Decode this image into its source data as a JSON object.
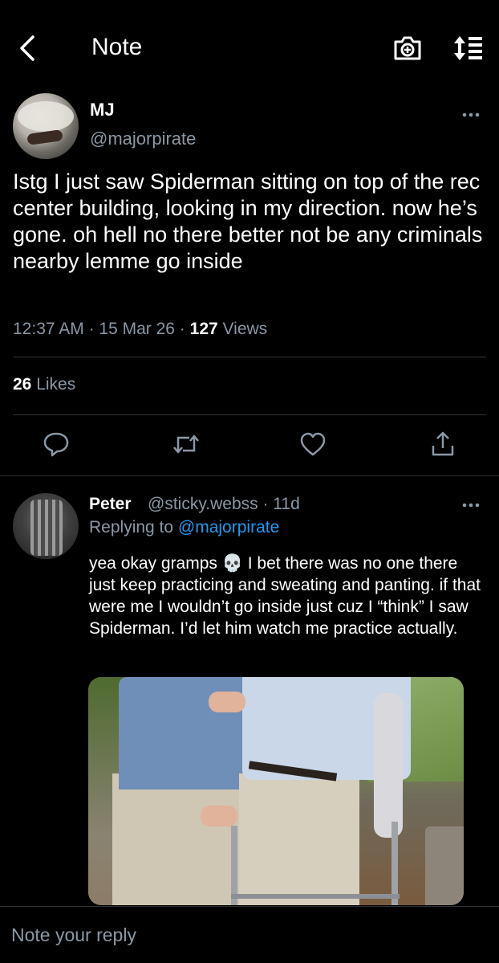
{
  "header": {
    "title": "Note",
    "icons": [
      "back-chevron-icon",
      "camera-icon",
      "sort-icon"
    ]
  },
  "tweet": {
    "author_name": "MJ",
    "author_handle": "@majorpirate",
    "text": "Istg I just saw Spiderman sitting on top of the rec center building, looking in my direction. now he’s gone. oh hell no there better not be any criminals nearby lemme go inside",
    "time": "12:37 AM",
    "sep1": " · ",
    "date": "15 Mar 26",
    "sep2": " · ",
    "views_count": "127",
    "views_label": " Views",
    "likes_count": "26",
    "likes_label": " Likes"
  },
  "actions": [
    "reply-icon",
    "retweet-icon",
    "like-icon",
    "share-icon"
  ],
  "reply": {
    "author_name": "Peter",
    "author_handle": "@sticky.webss",
    "sep": " · ",
    "age": "11d",
    "replying_prefix": "Replying to ",
    "replying_handle": "@majorpirate",
    "text": "yea okay gramps 💀 I bet there was no one there just keep practicing and sweating and panting. if that were me I wouldn’t go inside just cuz I “think” I saw Spiderman. I’d let him watch me practice actually."
  },
  "composer": {
    "placeholder": "Note your reply"
  },
  "colors": {
    "background": "#000000",
    "text": "#e7e9ea",
    "muted": "#8b98a5",
    "link": "#1d9bf0",
    "divider": "#2f3336"
  }
}
